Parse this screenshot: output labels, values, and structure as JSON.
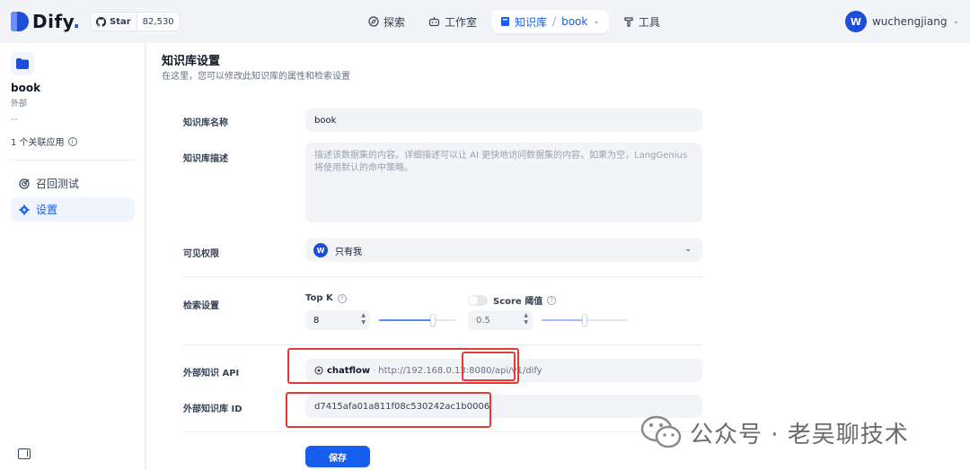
{
  "brand": {
    "name": "Dify",
    "suffix": "."
  },
  "github": {
    "label": "Star",
    "count": "82,530"
  },
  "nav": {
    "explore": "探索",
    "studio": "工作室",
    "knowledge": "知识库",
    "knowledge_sep": "/",
    "knowledge_current": "book",
    "tools": "工具"
  },
  "user": {
    "initial": "W",
    "name": "wuchengjiang"
  },
  "sidebar": {
    "dataset_name": "book",
    "dataset_type": "外部",
    "dataset_desc": "--",
    "linked_apps": "1 个关联应用",
    "items": [
      {
        "label": "召回测试",
        "icon": "target-icon",
        "active": false
      },
      {
        "label": "设置",
        "icon": "gear-icon",
        "active": true
      }
    ]
  },
  "main": {
    "title": "知识库设置",
    "subtitle": "在这里，您可以修改此知识库的属性和检索设置",
    "name_label": "知识库名称",
    "name_value": "book",
    "desc_label": "知识库描述",
    "desc_placeholder": "描述该数据集的内容。详细描述可以让 AI 更快地访问数据集的内容。如果为空，LangGenius 将使用默认的命中策略。",
    "permission_label": "可见权限",
    "permission_initial": "W",
    "permission_value": "只有我",
    "retrieval_label": "检索设置",
    "topk_label": "Top K",
    "topk_value": "8",
    "topk_fraction": 0.7,
    "score_label": "Score 阈值",
    "score_value": "0.5",
    "score_fraction": 0.5,
    "score_enabled": false,
    "api_label": "外部知识 API",
    "api_name": "chatflow",
    "api_sep": "·",
    "api_url": "http://192.168.0.13:8080/api/v1/dify",
    "external_id_label": "外部知识库 ID",
    "external_id_value": "d7415afa01a811f08c530242ac1b0006",
    "save_label": "保存"
  },
  "watermark": {
    "text": "公众号 · 老吴聊技术"
  },
  "colors": {
    "accent": "#155eef",
    "highlight": "#e53935"
  }
}
